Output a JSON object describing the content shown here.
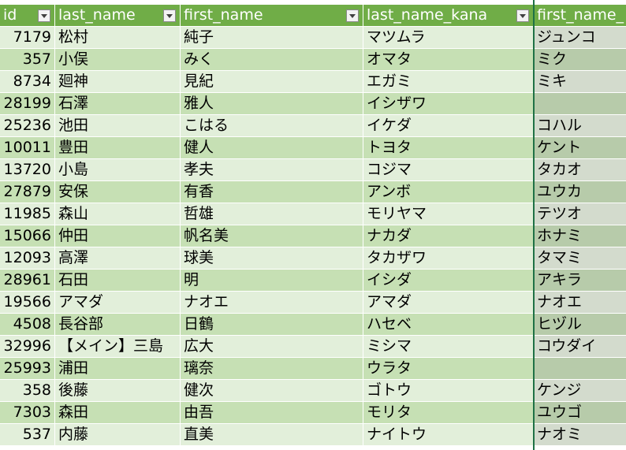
{
  "sheet": {
    "columns": [
      "id",
      "last_name",
      "first_name",
      "last_name_kana",
      "first_name_"
    ],
    "rows": [
      {
        "id": "7179",
        "last_name": "松村",
        "first_name": "純子",
        "last_name_kana": "マツムラ",
        "first_name_kana": "ジュンコ"
      },
      {
        "id": "357",
        "last_name": "小俣",
        "first_name": "みく",
        "last_name_kana": "オマタ",
        "first_name_kana": "ミク"
      },
      {
        "id": "8734",
        "last_name": "廻神",
        "first_name": "見紀",
        "last_name_kana": "エガミ",
        "first_name_kana": "ミキ"
      },
      {
        "id": "28199",
        "last_name": "石澤",
        "first_name": "雅人",
        "last_name_kana": "イシザワ",
        "first_name_kana": ""
      },
      {
        "id": "25236",
        "last_name": "池田",
        "first_name": "こはる",
        "last_name_kana": "イケダ",
        "first_name_kana": "コハル"
      },
      {
        "id": "10011",
        "last_name": "豊田",
        "first_name": "健人",
        "last_name_kana": "トヨタ",
        "first_name_kana": "ケント"
      },
      {
        "id": "13720",
        "last_name": "小島",
        "first_name": "孝夫",
        "last_name_kana": "コジマ",
        "first_name_kana": "タカオ"
      },
      {
        "id": "27879",
        "last_name": "安保",
        "first_name": "有香",
        "last_name_kana": "アンボ",
        "first_name_kana": "ユウカ"
      },
      {
        "id": "11985",
        "last_name": "森山",
        "first_name": "哲雄",
        "last_name_kana": "モリヤマ",
        "first_name_kana": "テツオ"
      },
      {
        "id": "15066",
        "last_name": "仲田",
        "first_name": "帆名美",
        "last_name_kana": "ナカダ",
        "first_name_kana": "ホナミ"
      },
      {
        "id": "12093",
        "last_name": "高澤",
        "first_name": "球美",
        "last_name_kana": "タカザワ",
        "first_name_kana": "タマミ"
      },
      {
        "id": "28961",
        "last_name": "石田",
        "first_name": "明",
        "last_name_kana": "イシダ",
        "first_name_kana": "アキラ"
      },
      {
        "id": "19566",
        "last_name": "アマダ",
        "first_name": "ナオエ",
        "last_name_kana": "アマダ",
        "first_name_kana": "ナオエ"
      },
      {
        "id": "4508",
        "last_name": "長谷部",
        "first_name": "日鶴",
        "last_name_kana": "ハセベ",
        "first_name_kana": "ヒヅル"
      },
      {
        "id": "32996",
        "last_name": "【メイン】三島",
        "first_name": "広大",
        "last_name_kana": "ミシマ",
        "first_name_kana": "コウダイ"
      },
      {
        "id": "25993",
        "last_name": "浦田",
        "first_name": "璃奈",
        "last_name_kana": "ウラタ",
        "first_name_kana": ""
      },
      {
        "id": "358",
        "last_name": "後藤",
        "first_name": "健次",
        "last_name_kana": "ゴトウ",
        "first_name_kana": "ケンジ"
      },
      {
        "id": "7303",
        "last_name": "森田",
        "first_name": "由吾",
        "last_name_kana": "モリタ",
        "first_name_kana": "ユウゴ"
      },
      {
        "id": "537",
        "last_name": "内藤",
        "first_name": "直美",
        "last_name_kana": "ナイトウ",
        "first_name_kana": "ナオミ"
      }
    ]
  },
  "colors": {
    "header": "#70ad47",
    "band_light": "#e2efda",
    "band_dark": "#c6e0b4",
    "selection": "#1f7145"
  },
  "icons": {
    "filter": "filter-dropdown-icon"
  }
}
